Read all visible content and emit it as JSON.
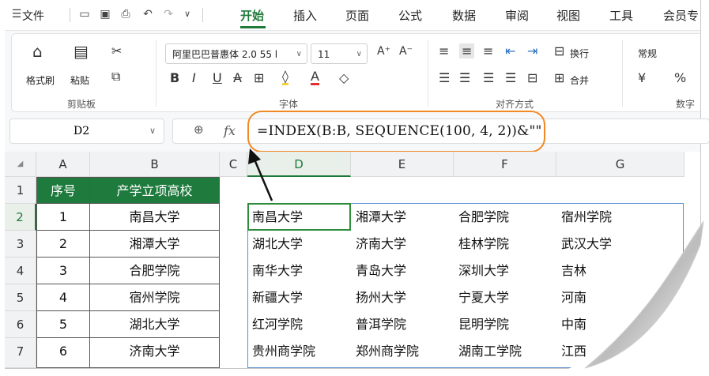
{
  "menu": {
    "file_label": "文件",
    "tabs": [
      "开始",
      "插入",
      "页面",
      "公式",
      "数据",
      "审阅",
      "视图",
      "工具",
      "会员专"
    ]
  },
  "ribbon": {
    "format_painter": "格式刷",
    "paste": "粘贴",
    "clipboard_group": "剪贴板",
    "font_name": "阿里巴巴普惠体 2.0 55 l",
    "font_size": "11",
    "font_group": "字体",
    "wrap": "换行",
    "merge": "合并",
    "align_group": "对齐方式",
    "number_format": "常规",
    "currency": "¥",
    "percent": "%",
    "number_group": "数字"
  },
  "formula_bar": {
    "name_box": "D2",
    "fx": "fx",
    "formula": "=INDEX(B:B, SEQUENCE(100, 4, 2))&\"\""
  },
  "columns": [
    "A",
    "B",
    "C",
    "D",
    "E",
    "F",
    "G"
  ],
  "rows": [
    "1",
    "2",
    "3",
    "4",
    "5",
    "6",
    "7"
  ],
  "table": {
    "header": [
      "序号",
      "产学立项高校"
    ],
    "rows": [
      [
        "1",
        "南昌大学"
      ],
      [
        "2",
        "湘潭大学"
      ],
      [
        "3",
        "合肥学院"
      ],
      [
        "4",
        "宿州学院"
      ],
      [
        "5",
        "湖北大学"
      ],
      [
        "6",
        "济南大学"
      ]
    ]
  },
  "result": [
    [
      "南昌大学",
      "湘潭大学",
      "合肥学院",
      "宿州学院"
    ],
    [
      "湖北大学",
      "济南大学",
      "桂林学院",
      "武汉大学"
    ],
    [
      "南华大学",
      "青岛大学",
      "深圳大学",
      "吉林"
    ],
    [
      "新疆大学",
      "扬州大学",
      "宁夏大学",
      "河南"
    ],
    [
      "红河学院",
      "普洱学院",
      "昆明学院",
      "中南"
    ],
    [
      "贵州商学院",
      "郑州商学院",
      "湖南工学院",
      "江西"
    ]
  ]
}
